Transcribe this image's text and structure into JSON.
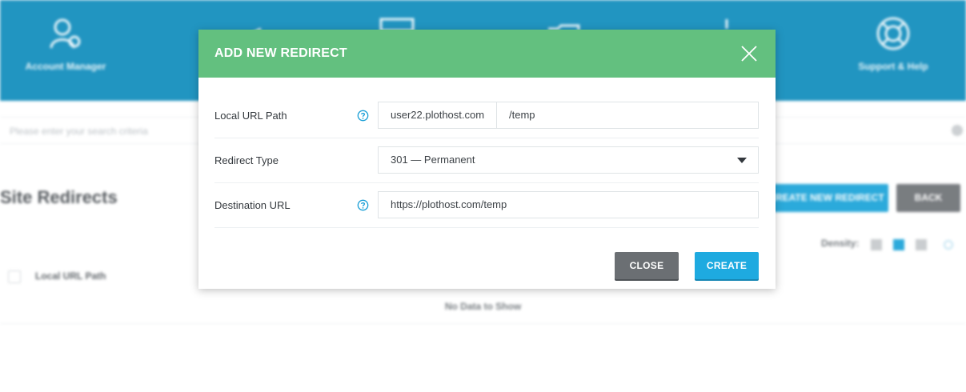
{
  "background": {
    "nav": [
      {
        "label": "Account Manager",
        "icon": "account-manager-icon"
      },
      {
        "label": "Support & Help",
        "icon": "lifebuoy-icon"
      }
    ],
    "search_placeholder": "Please enter your search criteria",
    "page_title": "Site Redirects",
    "create_button": "CREATE NEW REDIRECT",
    "back_button": "BACK",
    "density_label": "Density:",
    "table_column": "Local URL Path",
    "no_data": "No Data to Show"
  },
  "modal": {
    "title": "ADD NEW REDIRECT",
    "rows": {
      "local_url": {
        "label": "Local URL Path",
        "domain": "user22.plothost.com",
        "path": "/temp"
      },
      "redirect_type": {
        "label": "Redirect Type",
        "selected": "301 — Permanent"
      },
      "destination": {
        "label": "Destination URL",
        "value": "https://plothost.com/temp"
      }
    },
    "buttons": {
      "close": "CLOSE",
      "create": "CREATE"
    }
  },
  "colors": {
    "header_green": "#63c07f",
    "topbar_blue": "#0f8cbc",
    "primary_blue": "#1eaae0",
    "secondary_gray": "#6b6f73",
    "help_icon": "#1a9fd6"
  }
}
